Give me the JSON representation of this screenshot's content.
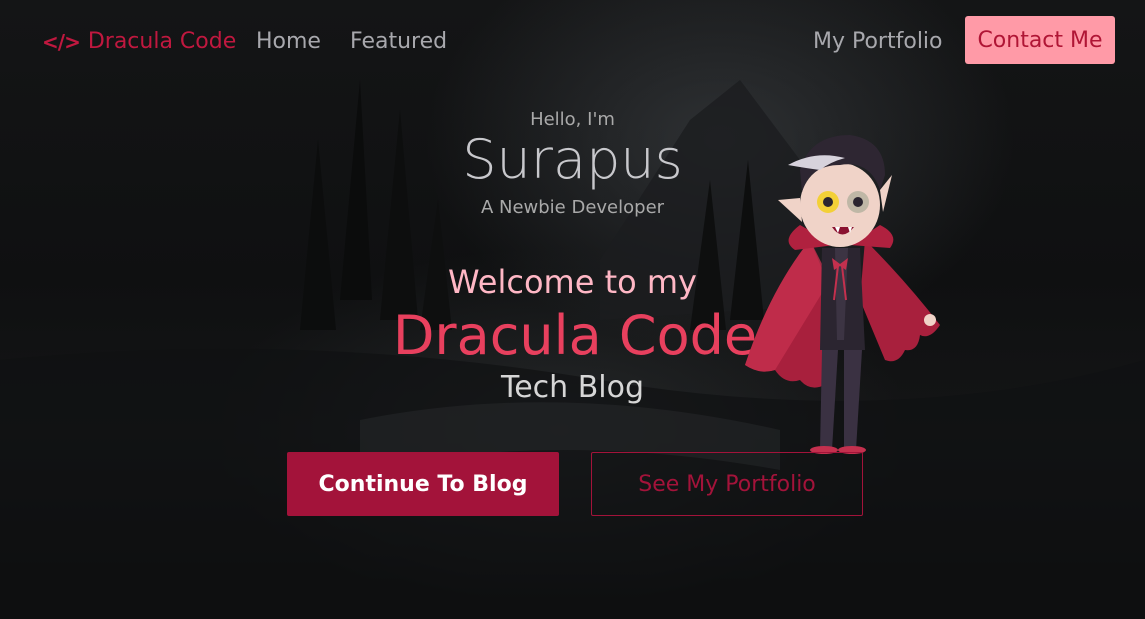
{
  "nav": {
    "brand_icon": "</>",
    "brand_label": "Dracula Code",
    "links": [
      "Home",
      "Featured"
    ],
    "portfolio_label": "My Portfolio",
    "contact_label": "Contact Me"
  },
  "hero": {
    "greeting": "Hello, I'm",
    "name": "Surapus",
    "tagline": "A Newbie Developer",
    "welcome": "Welcome to my",
    "site_name": "Dracula Code",
    "subtitle": "Tech Blog"
  },
  "actions": {
    "primary_label": "Continue To Blog",
    "secondary_label": "See My Portfolio"
  },
  "colors": {
    "accent": "#a3133a",
    "brand": "#c0183f",
    "contact_bg": "#ff9aa7",
    "welcome": "#ffb7c5",
    "site_name": "#e8405e"
  },
  "icons": {
    "brand": "code-icon",
    "illustration": "dracula-character"
  }
}
